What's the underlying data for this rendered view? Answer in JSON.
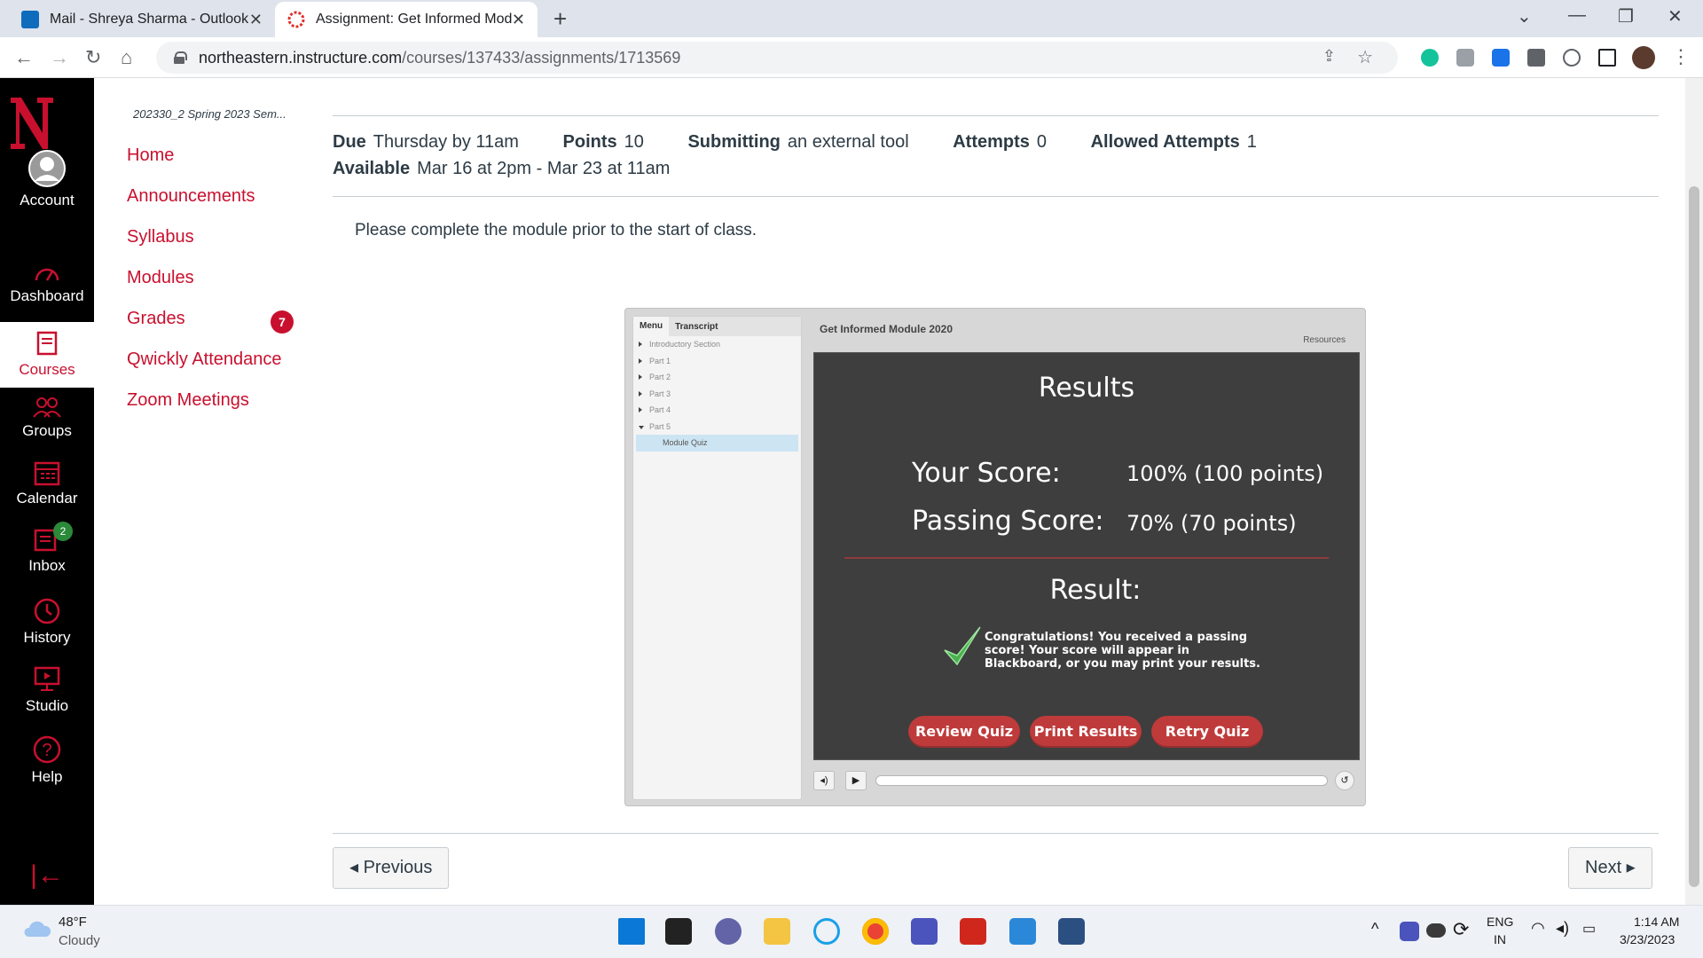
{
  "browser": {
    "tabs": [
      {
        "title": "Mail - Shreya Sharma - Outlook",
        "active": false
      },
      {
        "title": "Assignment: Get Informed Modu",
        "active": true
      }
    ],
    "url_host": "northeastern.instructure.com",
    "url_path": "/courses/137433/assignments/1713569",
    "close_glyph": "✕",
    "newtab_glyph": "+"
  },
  "global_nav": {
    "items": [
      {
        "label": "Account"
      },
      {
        "label": "Dashboard"
      },
      {
        "label": "Courses"
      },
      {
        "label": "Groups"
      },
      {
        "label": "Calendar"
      },
      {
        "label": "Inbox",
        "badge": "2"
      },
      {
        "label": "History"
      },
      {
        "label": "Studio"
      },
      {
        "label": "Help"
      }
    ],
    "collapse_glyph": "|←"
  },
  "course_nav": {
    "term": "202330_2 Spring 2023 Sem...",
    "items": [
      {
        "label": "Home"
      },
      {
        "label": "Announcements"
      },
      {
        "label": "Syllabus"
      },
      {
        "label": "Modules"
      },
      {
        "label": "Grades",
        "badge": "7"
      },
      {
        "label": "Qwickly Attendance"
      },
      {
        "label": "Zoom Meetings"
      }
    ]
  },
  "assignment": {
    "due_label": "Due",
    "due_value": "Thursday by 11am",
    "points_label": "Points",
    "points_value": "10",
    "submitting_label": "Submitting",
    "submitting_value": "an external tool",
    "attempts_label": "Attempts",
    "attempts_value": "0",
    "allowed_label": "Allowed Attempts",
    "allowed_value": "1",
    "available_label": "Available",
    "available_value": "Mar 16 at 2pm - Mar 23 at 11am",
    "description": "Please complete the module prior to the start of class."
  },
  "player": {
    "tabs": [
      "Menu",
      "Transcript"
    ],
    "menu": [
      "Introductory Section",
      "Part 1",
      "Part 2",
      "Part 3",
      "Part 4",
      "Part 5"
    ],
    "selected_sub": "Module Quiz",
    "title": "Get Informed Module 2020",
    "resources": "Resources",
    "results_heading": "Results",
    "your_score_label": "Your Score:",
    "your_score_value": "100% (100 points)",
    "passing_label": "Passing Score:",
    "passing_value": "70% (70 points)",
    "result_label": "Result:",
    "congrats_text": "Congratulations! You received a passing score! Your score will appear in Blackboard, or you may print your results.",
    "buttons": {
      "review": "Review Quiz",
      "print": "Print Results",
      "retry": "Retry Quiz"
    },
    "progress": 0
  },
  "footer": {
    "previous": "◂ Previous",
    "next": "Next ▸"
  },
  "taskbar": {
    "temp": "48°F",
    "weather": "Cloudy",
    "lang1": "ENG",
    "lang2": "IN",
    "time": "1:14 AM",
    "date": "3/23/2023"
  },
  "colors": {
    "brand_red": "#c8102e",
    "nav_bg": "#000000",
    "slide_bg": "#3e3e3e",
    "button_red": "#bf3b3b"
  }
}
